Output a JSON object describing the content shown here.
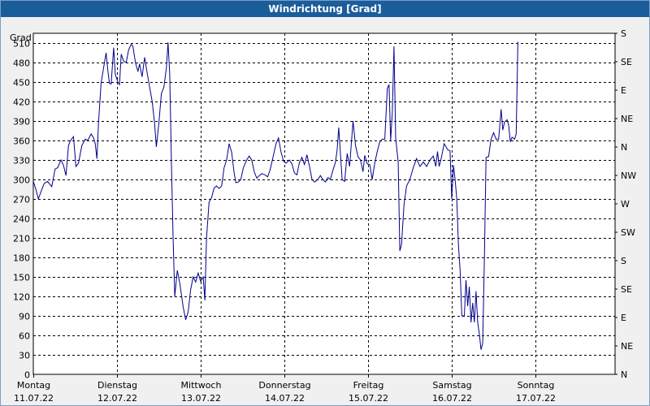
{
  "window": {
    "title": "Windrichtung [Grad]"
  },
  "chart_data": {
    "type": "line",
    "title": "Windrichtung [Grad]",
    "ylabel": "Grad",
    "ylim": [
      0,
      525
    ],
    "xlim": [
      0,
      7
    ],
    "yticks": [
      0,
      30,
      60,
      90,
      120,
      150,
      180,
      210,
      240,
      270,
      300,
      330,
      360,
      390,
      420,
      450,
      480,
      510
    ],
    "right_ticks": [
      {
        "value": 0,
        "label": "N"
      },
      {
        "value": 45,
        "label": "NE"
      },
      {
        "value": 90,
        "label": "E"
      },
      {
        "value": 135,
        "label": "SE"
      },
      {
        "value": 180,
        "label": "S"
      },
      {
        "value": 225,
        "label": "SW"
      },
      {
        "value": 270,
        "label": "W"
      },
      {
        "value": 315,
        "label": "NW"
      },
      {
        "value": 360,
        "label": "N"
      },
      {
        "value": 405,
        "label": "NE"
      },
      {
        "value": 450,
        "label": "E"
      },
      {
        "value": 495,
        "label": "SE"
      },
      {
        "value": 540,
        "label": "S"
      }
    ],
    "x_labels": [
      {
        "day": "Montag",
        "date": "11.07.22"
      },
      {
        "day": "Dienstag",
        "date": "12.07.22"
      },
      {
        "day": "Mittwoch",
        "date": "13.07.22"
      },
      {
        "day": "Donnerstag",
        "date": "14.07.22"
      },
      {
        "day": "Freitag",
        "date": "15.07.22"
      },
      {
        "day": "Samstag",
        "date": "16.07.22"
      },
      {
        "day": "Sonntag",
        "date": "17.07.22"
      }
    ],
    "grid": true,
    "series": [
      {
        "color": "#00008b",
        "points": [
          [
            0.0,
            297
          ],
          [
            0.03,
            285
          ],
          [
            0.06,
            270
          ],
          [
            0.1,
            284
          ],
          [
            0.13,
            294
          ],
          [
            0.17,
            297
          ],
          [
            0.22,
            289
          ],
          [
            0.26,
            316
          ],
          [
            0.29,
            318
          ],
          [
            0.33,
            330
          ],
          [
            0.36,
            322
          ],
          [
            0.39,
            306
          ],
          [
            0.42,
            352
          ],
          [
            0.44,
            359
          ],
          [
            0.48,
            366
          ],
          [
            0.51,
            320
          ],
          [
            0.54,
            325
          ],
          [
            0.58,
            352
          ],
          [
            0.62,
            362
          ],
          [
            0.65,
            360
          ],
          [
            0.69,
            370
          ],
          [
            0.72,
            364
          ],
          [
            0.74,
            355
          ],
          [
            0.76,
            332
          ],
          [
            0.78,
            388
          ],
          [
            0.81,
            448
          ],
          [
            0.84,
            472
          ],
          [
            0.87,
            495
          ],
          [
            0.89,
            468
          ],
          [
            0.91,
            448
          ],
          [
            0.93,
            447
          ],
          [
            0.96,
            503
          ],
          [
            0.98,
            462
          ],
          [
            1.01,
            450
          ],
          [
            1.03,
            446
          ],
          [
            1.05,
            493
          ],
          [
            1.08,
            482
          ],
          [
            1.11,
            480
          ],
          [
            1.14,
            500
          ],
          [
            1.17,
            508
          ],
          [
            1.19,
            505
          ],
          [
            1.22,
            480
          ],
          [
            1.25,
            466
          ],
          [
            1.27,
            478
          ],
          [
            1.3,
            458
          ],
          [
            1.33,
            488
          ],
          [
            1.36,
            464
          ],
          [
            1.39,
            442
          ],
          [
            1.42,
            420
          ],
          [
            1.45,
            386
          ],
          [
            1.47,
            350
          ],
          [
            1.5,
            386
          ],
          [
            1.53,
            432
          ],
          [
            1.56,
            442
          ],
          [
            1.59,
            472
          ],
          [
            1.61,
            511
          ],
          [
            1.63,
            462
          ],
          [
            1.65,
            330
          ],
          [
            1.67,
            212
          ],
          [
            1.69,
            120
          ],
          [
            1.72,
            160
          ],
          [
            1.75,
            140
          ],
          [
            1.79,
            104
          ],
          [
            1.82,
            84
          ],
          [
            1.85,
            96
          ],
          [
            1.88,
            130
          ],
          [
            1.91,
            150
          ],
          [
            1.94,
            142
          ],
          [
            1.97,
            156
          ],
          [
            2.0,
            143
          ],
          [
            2.03,
            150
          ],
          [
            2.05,
            114
          ],
          [
            2.07,
            210
          ],
          [
            2.1,
            265
          ],
          [
            2.13,
            272
          ],
          [
            2.16,
            287
          ],
          [
            2.19,
            290
          ],
          [
            2.22,
            286
          ],
          [
            2.25,
            290
          ],
          [
            2.28,
            318
          ],
          [
            2.31,
            330
          ],
          [
            2.34,
            355
          ],
          [
            2.37,
            342
          ],
          [
            2.4,
            310
          ],
          [
            2.42,
            295
          ],
          [
            2.45,
            296
          ],
          [
            2.48,
            300
          ],
          [
            2.51,
            318
          ],
          [
            2.55,
            330
          ],
          [
            2.58,
            336
          ],
          [
            2.61,
            330
          ],
          [
            2.64,
            312
          ],
          [
            2.67,
            302
          ],
          [
            2.7,
            306
          ],
          [
            2.73,
            309
          ],
          [
            2.77,
            307
          ],
          [
            2.8,
            304
          ],
          [
            2.83,
            315
          ],
          [
            2.86,
            332
          ],
          [
            2.9,
            355
          ],
          [
            2.93,
            364
          ],
          [
            2.96,
            342
          ],
          [
            2.99,
            328
          ],
          [
            3.02,
            325
          ],
          [
            3.06,
            330
          ],
          [
            3.09,
            324
          ],
          [
            3.12,
            310
          ],
          [
            3.15,
            307
          ],
          [
            3.18,
            326
          ],
          [
            3.21,
            334
          ],
          [
            3.24,
            323
          ],
          [
            3.27,
            338
          ],
          [
            3.3,
            320
          ],
          [
            3.33,
            300
          ],
          [
            3.36,
            296
          ],
          [
            3.4,
            300
          ],
          [
            3.43,
            306
          ],
          [
            3.46,
            300
          ],
          [
            3.49,
            296
          ],
          [
            3.52,
            303
          ],
          [
            3.55,
            300
          ],
          [
            3.58,
            314
          ],
          [
            3.61,
            326
          ],
          [
            3.63,
            345
          ],
          [
            3.65,
            380
          ],
          [
            3.67,
            340
          ],
          [
            3.69,
            300
          ],
          [
            3.72,
            297
          ],
          [
            3.75,
            340
          ],
          [
            3.78,
            320
          ],
          [
            3.82,
            390
          ],
          [
            3.85,
            352
          ],
          [
            3.88,
            335
          ],
          [
            3.91,
            330
          ],
          [
            3.94,
            312
          ],
          [
            3.96,
            337
          ],
          [
            3.99,
            324
          ],
          [
            4.02,
            323
          ],
          [
            4.05,
            300
          ],
          [
            4.08,
            325
          ],
          [
            4.11,
            343
          ],
          [
            4.14,
            358
          ],
          [
            4.17,
            362
          ],
          [
            4.2,
            362
          ],
          [
            4.23,
            440
          ],
          [
            4.25,
            446
          ],
          [
            4.27,
            360
          ],
          [
            4.29,
            405
          ],
          [
            4.31,
            505
          ],
          [
            4.33,
            364
          ],
          [
            4.36,
            326
          ],
          [
            4.38,
            190
          ],
          [
            4.4,
            200
          ],
          [
            4.43,
            262
          ],
          [
            4.46,
            290
          ],
          [
            4.5,
            300
          ],
          [
            4.54,
            318
          ],
          [
            4.58,
            332
          ],
          [
            4.62,
            320
          ],
          [
            4.66,
            327
          ],
          [
            4.7,
            320
          ],
          [
            4.74,
            330
          ],
          [
            4.78,
            336
          ],
          [
            4.81,
            320
          ],
          [
            4.83,
            343
          ],
          [
            4.85,
            320
          ],
          [
            4.87,
            330
          ],
          [
            4.91,
            355
          ],
          [
            4.95,
            346
          ],
          [
            4.98,
            344
          ],
          [
            5.0,
            270
          ],
          [
            5.02,
            322
          ],
          [
            5.04,
            300
          ],
          [
            5.06,
            270
          ],
          [
            5.08,
            200
          ],
          [
            5.1,
            160
          ],
          [
            5.12,
            90
          ],
          [
            5.15,
            90
          ],
          [
            5.17,
            145
          ],
          [
            5.19,
            105
          ],
          [
            5.21,
            135
          ],
          [
            5.23,
            80
          ],
          [
            5.25,
            110
          ],
          [
            5.27,
            80
          ],
          [
            5.29,
            128
          ],
          [
            5.31,
            80
          ],
          [
            5.33,
            62
          ],
          [
            5.35,
            38
          ],
          [
            5.37,
            48
          ],
          [
            5.39,
            180
          ],
          [
            5.41,
            334
          ],
          [
            5.44,
            335
          ],
          [
            5.47,
            362
          ],
          [
            5.5,
            372
          ],
          [
            5.53,
            362
          ],
          [
            5.56,
            362
          ],
          [
            5.59,
            408
          ],
          [
            5.61,
            376
          ],
          [
            5.63,
            388
          ],
          [
            5.66,
            392
          ],
          [
            5.68,
            384
          ],
          [
            5.7,
            358
          ],
          [
            5.72,
            365
          ],
          [
            5.75,
            362
          ],
          [
            5.77,
            370
          ],
          [
            5.79,
            512
          ]
        ]
      }
    ]
  }
}
